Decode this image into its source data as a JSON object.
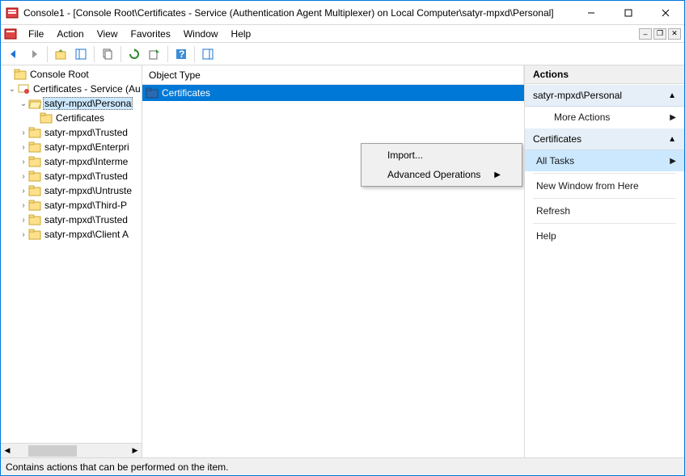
{
  "window": {
    "title": "Console1 - [Console Root\\Certificates - Service (Authentication Agent Multiplexer) on Local Computer\\satyr-mpxd\\Personal]"
  },
  "menus": [
    "File",
    "Action",
    "View",
    "Favorites",
    "Window",
    "Help"
  ],
  "tree": {
    "root": "Console Root",
    "certs_root": "Certificates - Service (Au",
    "selected": "satyr-mpxd\\Persona",
    "selected_child": "Certificates",
    "siblings": [
      "satyr-mpxd\\Trusted",
      "satyr-mpxd\\Enterpri",
      "satyr-mpxd\\Interme",
      "satyr-mpxd\\Trusted",
      "satyr-mpxd\\Untruste",
      "satyr-mpxd\\Third-P",
      "satyr-mpxd\\Trusted",
      "satyr-mpxd\\Client A"
    ]
  },
  "list": {
    "header": "Object Type",
    "row": "Certificates"
  },
  "context_menu": {
    "import": "Import...",
    "advanced": "Advanced Operations"
  },
  "actions": {
    "title": "Actions",
    "section1": "satyr-mpxd\\Personal",
    "more": "More Actions",
    "section2": "Certificates",
    "all_tasks": "All Tasks",
    "new_window": "New Window from Here",
    "refresh": "Refresh",
    "help": "Help"
  },
  "status": "Contains actions that can be performed on the item."
}
